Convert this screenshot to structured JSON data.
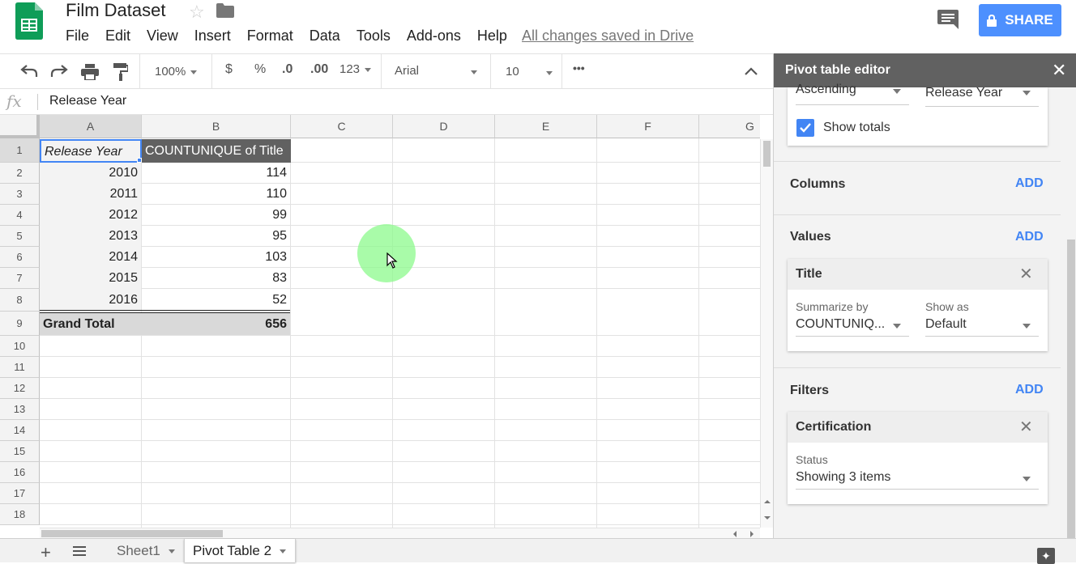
{
  "header": {
    "doc_title": "Film Dataset",
    "menu": [
      "File",
      "Edit",
      "View",
      "Insert",
      "Format",
      "Data",
      "Tools",
      "Add-ons",
      "Help"
    ],
    "save_status": "All changes saved in Drive",
    "share_label": "SHARE",
    "accent_color": "#4d90fe"
  },
  "toolbar": {
    "zoom": "100%",
    "currency": "$",
    "percent": "%",
    "decrease_decimals": ".0",
    "increase_decimals": ".00",
    "more_formats": "123",
    "font": "Arial",
    "font_size": "10",
    "more": "•••"
  },
  "formula_bar": {
    "fx": "fx",
    "value": "Release Year"
  },
  "grid": {
    "columns": [
      "A",
      "B",
      "C",
      "D",
      "E",
      "F",
      "G"
    ],
    "rows": [
      "1",
      "2",
      "3",
      "4",
      "5",
      "6",
      "7",
      "8",
      "9",
      "10",
      "11",
      "12",
      "13",
      "14",
      "15",
      "16",
      "17",
      "18"
    ],
    "header_row": {
      "a": "Release Year",
      "b": "COUNTUNIQUE of Title"
    },
    "data_rows": [
      {
        "a": "2010",
        "b": "114"
      },
      {
        "a": "2011",
        "b": "110"
      },
      {
        "a": "2012",
        "b": "99"
      },
      {
        "a": "2013",
        "b": "95"
      },
      {
        "a": "2014",
        "b": "103"
      },
      {
        "a": "2015",
        "b": "83"
      },
      {
        "a": "2016",
        "b": "52"
      }
    ],
    "grand_total": {
      "a": "Grand Total",
      "b": "656"
    }
  },
  "sheets": {
    "tabs": [
      "Sheet1",
      "Pivot Table 2"
    ],
    "active": "Pivot Table 2"
  },
  "panel": {
    "title": "Pivot table editor",
    "rows_card": {
      "order": "Ascending",
      "sort_by": "Release Year",
      "show_totals_label": "Show totals",
      "show_totals_checked": true
    },
    "columns_label": "Columns",
    "values_label": "Values",
    "filters_label": "Filters",
    "add_label": "ADD",
    "values_card": {
      "title": "Title",
      "summarize_label": "Summarize by",
      "summarize_value": "COUNTUNIQ...",
      "show_as_label": "Show as",
      "show_as_value": "Default"
    },
    "filters_card": {
      "title": "Certification",
      "status_label": "Status",
      "status_value": "Showing 3 items"
    }
  }
}
